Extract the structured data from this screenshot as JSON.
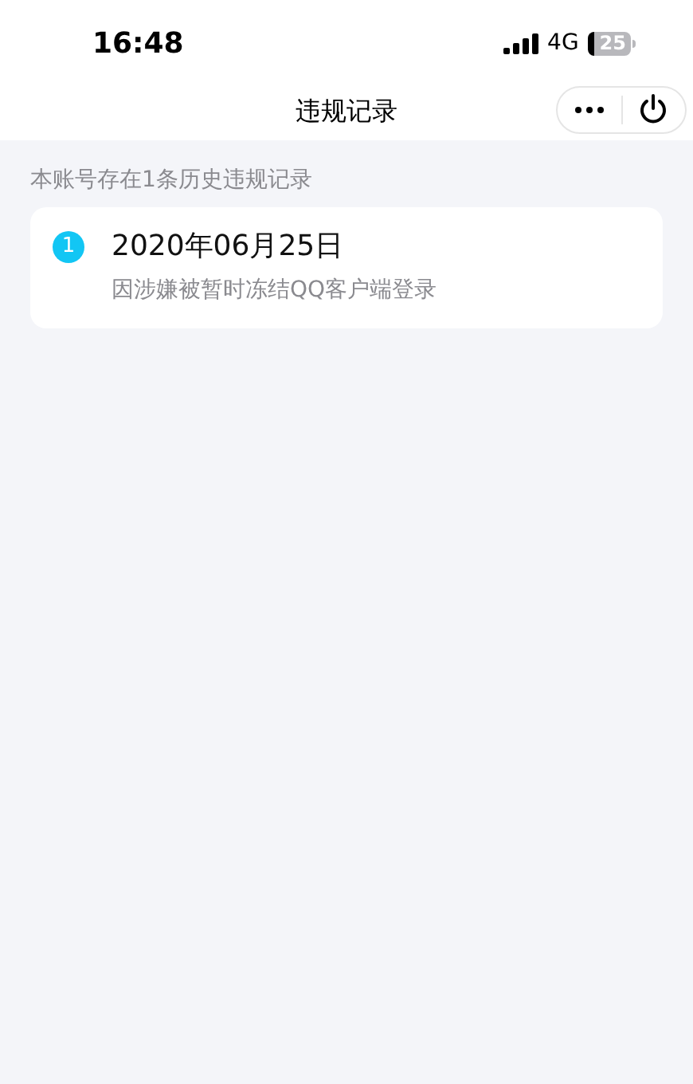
{
  "status_bar": {
    "time": "16:48",
    "network": "4G",
    "battery": "25"
  },
  "nav_bar": {
    "title": "违规记录"
  },
  "summary": "本账号存在1条历史违规记录",
  "records": [
    {
      "index": "1",
      "date": "2020年06月25日",
      "reason": "因涉嫌被暂时冻结QQ客户端登录"
    }
  ]
}
